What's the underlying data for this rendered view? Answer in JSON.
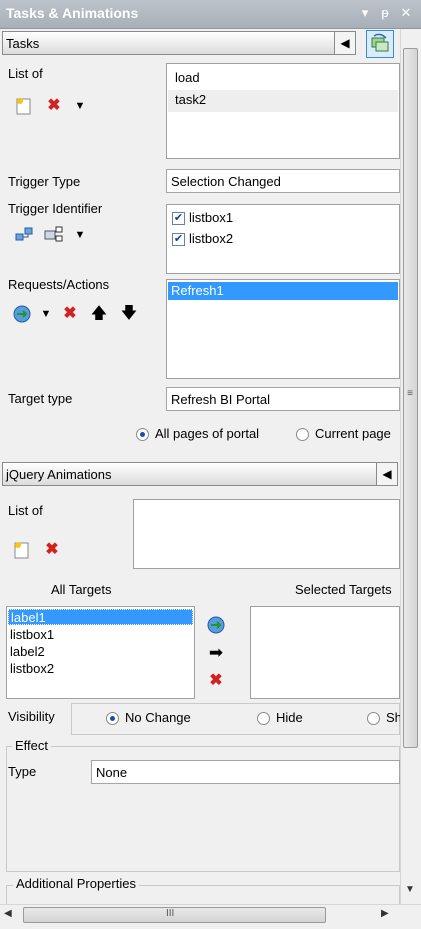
{
  "window": {
    "title": "Tasks & Animations"
  },
  "tasks_section": {
    "header": "Tasks"
  },
  "list_of": {
    "label": "List of",
    "items": [
      "load",
      "task2"
    ]
  },
  "trigger_type": {
    "label": "Trigger Type",
    "value": "Selection Changed"
  },
  "trigger_identifier": {
    "label": "Trigger Identifier",
    "items": [
      "listbox1",
      "listbox2"
    ]
  },
  "requests": {
    "label": "Requests/Actions",
    "items": [
      "Refresh1"
    ]
  },
  "target_type": {
    "label": "Target type",
    "value": "Refresh BI Portal"
  },
  "target_radios": {
    "all": "All pages of portal",
    "current": "Current page"
  },
  "jquery": {
    "header": "jQuery Animations",
    "list_label": "List of"
  },
  "targets": {
    "all_label": "All Targets",
    "selected_label": "Selected Targets",
    "all_items": [
      "label1",
      "listbox1",
      "label2",
      "listbox2"
    ]
  },
  "visibility": {
    "label": "Visibility",
    "no_change": "No Change",
    "hide": "Hide",
    "show": "Sh"
  },
  "effect": {
    "group_label": "Effect",
    "type_label": "Type",
    "type_value": "None"
  },
  "additional": {
    "label": "Additional Properties"
  },
  "hscroll": {
    "grip": "III"
  }
}
